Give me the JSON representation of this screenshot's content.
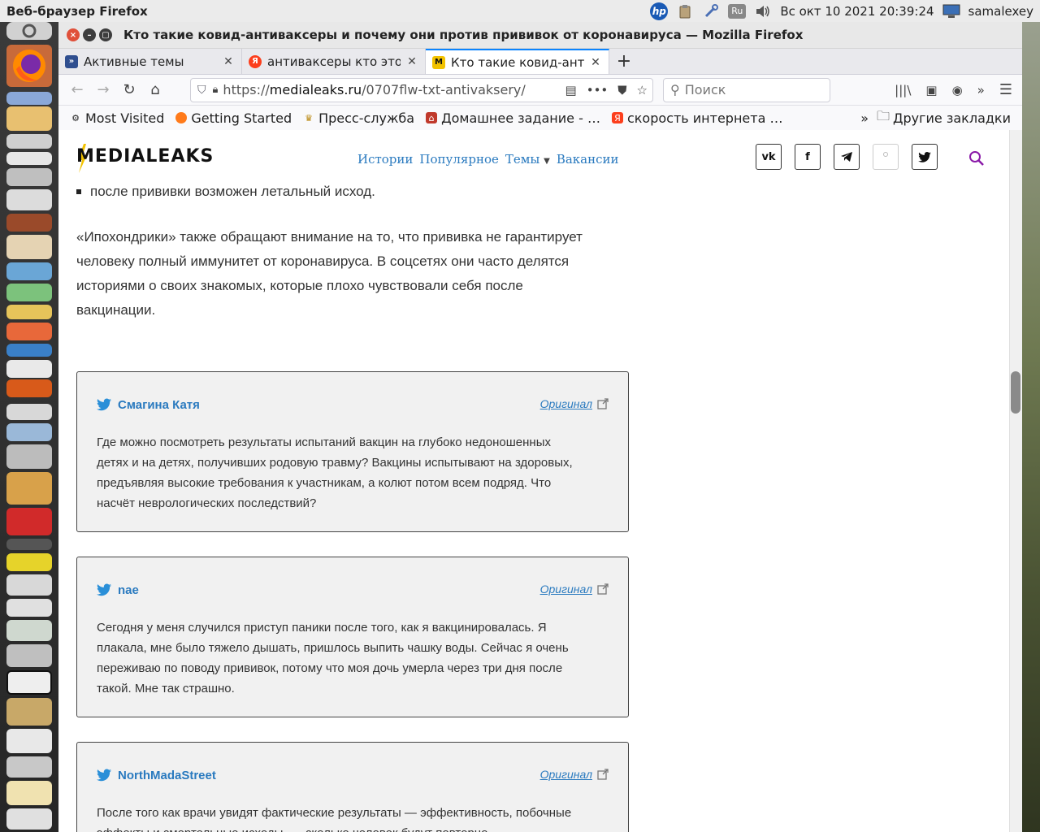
{
  "top_panel": {
    "app_title": "Веб-браузер Firefox",
    "keyboard_layout": "Ru",
    "clock": "Вс окт 10 2021 20:39:24",
    "user": "samalexey",
    "hp_label": "hp"
  },
  "window": {
    "title": "Кто такие ковид-антиваксеры и почему они против прививок от коронавируса — Mozilla Firefox"
  },
  "tabs": [
    {
      "label": "Активные темы",
      "favicon": "forum-icon",
      "active": false
    },
    {
      "label": "антиваксеры кто это",
      "favicon": "yandex-icon",
      "active": false
    },
    {
      "label": "Кто такие ковид-антиваксеры",
      "favicon": "medialeaks-icon",
      "active": true
    }
  ],
  "navbar": {
    "url_prefix": "https://",
    "url_domain": "medialeaks.ru",
    "url_path": "/0707flw-txt-antivaksery/",
    "search_placeholder": "Поиск",
    "more_dots": "•••"
  },
  "bookmarks": {
    "items": [
      {
        "label": "Most Visited",
        "icon": "gear-icon"
      },
      {
        "label": "Getting Started",
        "icon": "firefox-icon"
      },
      {
        "label": "Пресс-служба",
        "icon": "emblem-icon"
      },
      {
        "label": "Домашнее задание - …",
        "icon": "house-icon"
      },
      {
        "label": "скорость интернета …",
        "icon": "yandex-icon"
      }
    ],
    "overflow": "»",
    "other_folder": "Другие закладки"
  },
  "site": {
    "logo": "MEDIALEAKS",
    "nav": [
      "Истории",
      "Популярное",
      "Темы",
      "Вакансии"
    ],
    "socials": [
      "vk",
      "f",
      "telegram",
      "ok",
      "twitter"
    ]
  },
  "article": {
    "bullet": "после прививки возможен летальный исход.",
    "paragraph_lines": [
      "«Ипохондрики» также обращают внимание на то, что прививка не гарантирует",
      "человеку полный иммунитет от коронавируса. В соцсетях они часто делятся",
      "историями о своих знакомых, которые плохо чувствовали себя после",
      "вакцинации."
    ]
  },
  "tweets": [
    {
      "author": "Смагина Катя",
      "original": "Оригинал",
      "lines": [
        "Где можно посмотреть результаты испытаний вакцин на глубоко недоношенных",
        "детях и на детях, получивших родовую травму? Вакцины испытывают на здоровых,",
        "предъявляя высокие требования к участникам, а колют потом всем подряд. Что",
        "насчёт неврологических последствий?"
      ]
    },
    {
      "author": "nae",
      "original": "Оригинал",
      "lines": [
        "Сегодня у меня случился приступ паники после того, как я вакцинировалась. Я",
        "плакала, мне было тяжело дышать, пришлось выпить чашку воды. Сейчас я очень",
        "переживаю по поводу прививок, потому что моя дочь умерла через три дня после",
        "такой. Мне так страшно."
      ]
    },
    {
      "author": "NorthMadaStreet",
      "original": "Оригинал",
      "lines": [
        "После того как врачи увидят фактические результаты — эффективность, побочные",
        "эффекты и смертельные исходы, — сколько человек будут повторно"
      ]
    }
  ],
  "colors": {
    "link_blue": "#2a7abf",
    "tab_accent": "#0a84ff",
    "logo_bolt": "#f2c200"
  }
}
